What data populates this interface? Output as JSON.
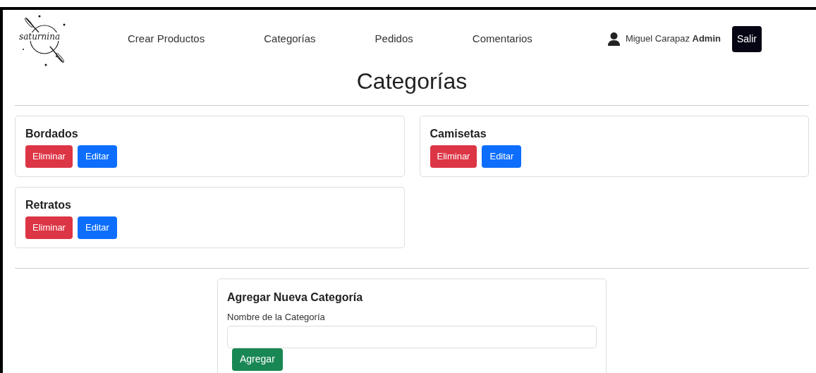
{
  "logo": {
    "text": "saturnina"
  },
  "nav": {
    "links": [
      "Crear Productos",
      "Categorías",
      "Pedidos",
      "Comentarios"
    ],
    "user": "Miguel Carapaz **Admin**",
    "logout": "Salir"
  },
  "title": "Categorías",
  "categories": [
    {
      "name": "Bordados",
      "delete": "Eliminar",
      "edit": "Editar"
    },
    {
      "name": "Camisetas",
      "delete": "Eliminar",
      "edit": "Editar"
    },
    {
      "name": "Retratos",
      "delete": "Eliminar",
      "edit": "Editar"
    }
  ],
  "form": {
    "title": "Agregar Nueva Categoría",
    "label": "Nombre de la Categoría",
    "submit": "Agregar"
  }
}
